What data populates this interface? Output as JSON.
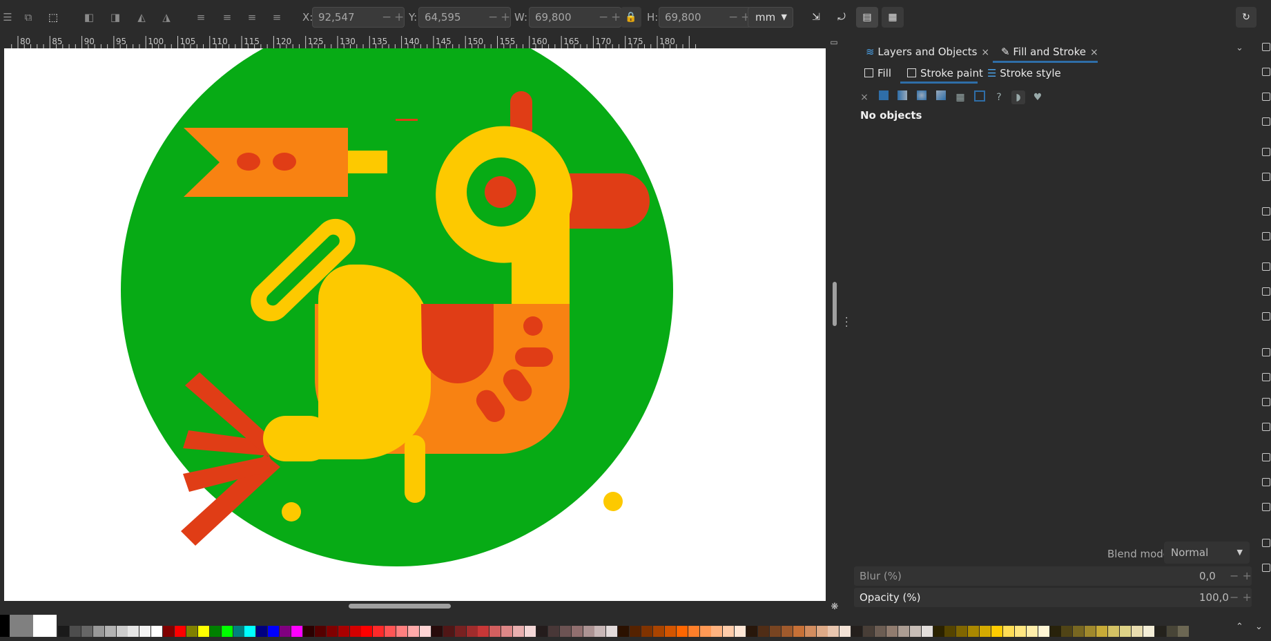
{
  "toolbar": {
    "x_label": "X:",
    "x_value": "92,547",
    "y_label": "Y:",
    "y_value": "64,595",
    "w_label": "W:",
    "w_value": "69,800",
    "h_label": "H:",
    "h_value": "69,800",
    "unit": "mm",
    "minus": "−",
    "plus": "+"
  },
  "ruler": {
    "ticks": [
      "80",
      "85",
      "90",
      "95",
      "100",
      "105",
      "110",
      "115",
      "120",
      "125",
      "130",
      "135",
      "140",
      "145",
      "150",
      "155",
      "160",
      "165",
      "170",
      "175",
      "180"
    ]
  },
  "panel": {
    "tabs": [
      {
        "label": "Layers and Objects",
        "close": "×"
      },
      {
        "label": "Fill and Stroke",
        "close": "×"
      }
    ],
    "subtabs": {
      "fill": "Fill",
      "stroke_paint": "Stroke paint",
      "stroke_style": "Stroke style"
    },
    "no_objects": "No objects",
    "blend_mode_label": "Blend mode:",
    "blend_mode_value": "Normal",
    "blur_label": "Blur (%)",
    "blur_value": "0,0",
    "opacity_label": "Opacity (%)",
    "opacity_value": "100,0"
  },
  "colors": {
    "circle": "#07ab15",
    "orange": "#f88212",
    "yellow": "#fdc900",
    "red": "#e03d16",
    "accent": "#2f6ea8"
  },
  "palette": [
    "#000000",
    "#808080",
    "#ffffff",
    "#1a1a1a",
    "#4d4d4d",
    "#666666",
    "#999999",
    "#b3b3b3",
    "#cccccc",
    "#e6e6e6",
    "#f2f2f2",
    "#ffffff",
    "#800000",
    "#ff0000",
    "#808000",
    "#ffff00",
    "#008000",
    "#00ff00",
    "#008080",
    "#00ffff",
    "#000080",
    "#0000ff",
    "#800080",
    "#ff00ff",
    "#2b0000",
    "#550000",
    "#800000",
    "#aa0000",
    "#d40000",
    "#ff0000",
    "#ff2a2a",
    "#ff5555",
    "#ff8080",
    "#ffaaaa",
    "#ffd5d5",
    "#280b0b",
    "#501616",
    "#782121",
    "#a02c2c",
    "#c83737",
    "#d35f5f",
    "#de8787",
    "#e9afaf",
    "#f4d7d7",
    "#241c1c",
    "#483737",
    "#6c5353",
    "#916f6f",
    "#ac9393",
    "#c8b7b7",
    "#e3dbdb",
    "#2b1100",
    "#552200",
    "#803300",
    "#aa4400",
    "#d45500",
    "#ff6600",
    "#ff7f2a",
    "#ff9955",
    "#ffb380",
    "#ffccaa",
    "#ffe6d5",
    "#28170b",
    "#502d16",
    "#784421",
    "#a05a2c",
    "#c87137",
    "#d38d5f",
    "#deaa87",
    "#e9c6af",
    "#f4e3d7",
    "#241f1c",
    "#483e37",
    "#6c5d53",
    "#917c6f",
    "#ac9d93",
    "#c8beb7",
    "#e3dedb",
    "#2b2200",
    "#554400",
    "#806600",
    "#aa8800",
    "#d4aa00",
    "#ffcc00",
    "#ffdd55",
    "#ffe680",
    "#ffeeaa",
    "#fff6d5",
    "#28220b",
    "#504416",
    "#786721",
    "#a0892c",
    "#c8ab37",
    "#d4c264",
    "#ded387",
    "#e9ddaf",
    "#f4eed7",
    "#24221c",
    "#484537",
    "#6c6753"
  ]
}
